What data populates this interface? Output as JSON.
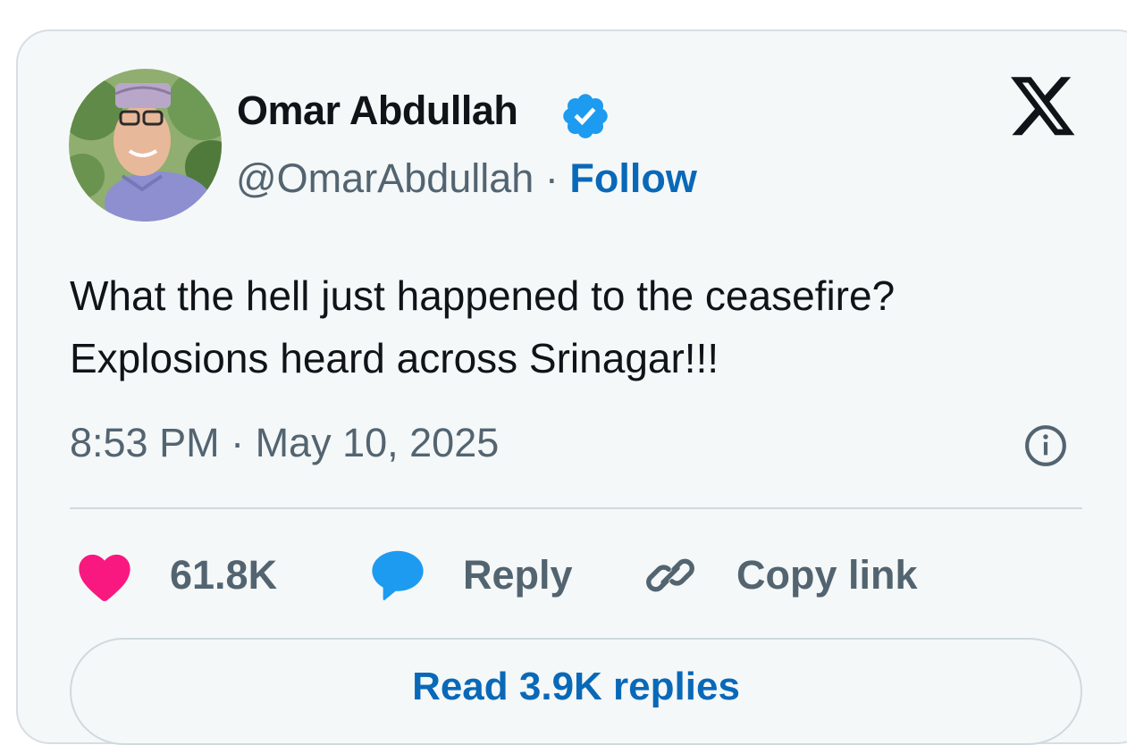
{
  "tweet": {
    "author": {
      "display_name": "Omar Abdullah",
      "handle": "@OmarAbdullah",
      "verified": true,
      "follow_label": "Follow",
      "separator": "·"
    },
    "text_lines": [
      "What the hell just happened to the ceasefire?",
      "Explosions heard across Srinagar!!!"
    ],
    "timestamp": "8:53 PM · May 10, 2025"
  },
  "actions": {
    "like_count": "61.8K",
    "reply_label": "Reply",
    "copy_link_label": "Copy link"
  },
  "replies_button": {
    "label": "Read 3.9K replies"
  },
  "icons": {
    "verified": "verified-badge-icon",
    "brand": "x-logo-icon",
    "info": "info-icon",
    "like": "heart-icon",
    "reply": "speech-bubble-icon",
    "copy": "link-icon"
  },
  "colors": {
    "accent": "#0969b8",
    "verified": "#1d9bf0",
    "like": "#f91880",
    "reply": "#1d9bf0",
    "text_primary": "#0f1419",
    "text_secondary": "#536471",
    "card_background": "#f5f8f8",
    "border": "#cfd9de"
  }
}
